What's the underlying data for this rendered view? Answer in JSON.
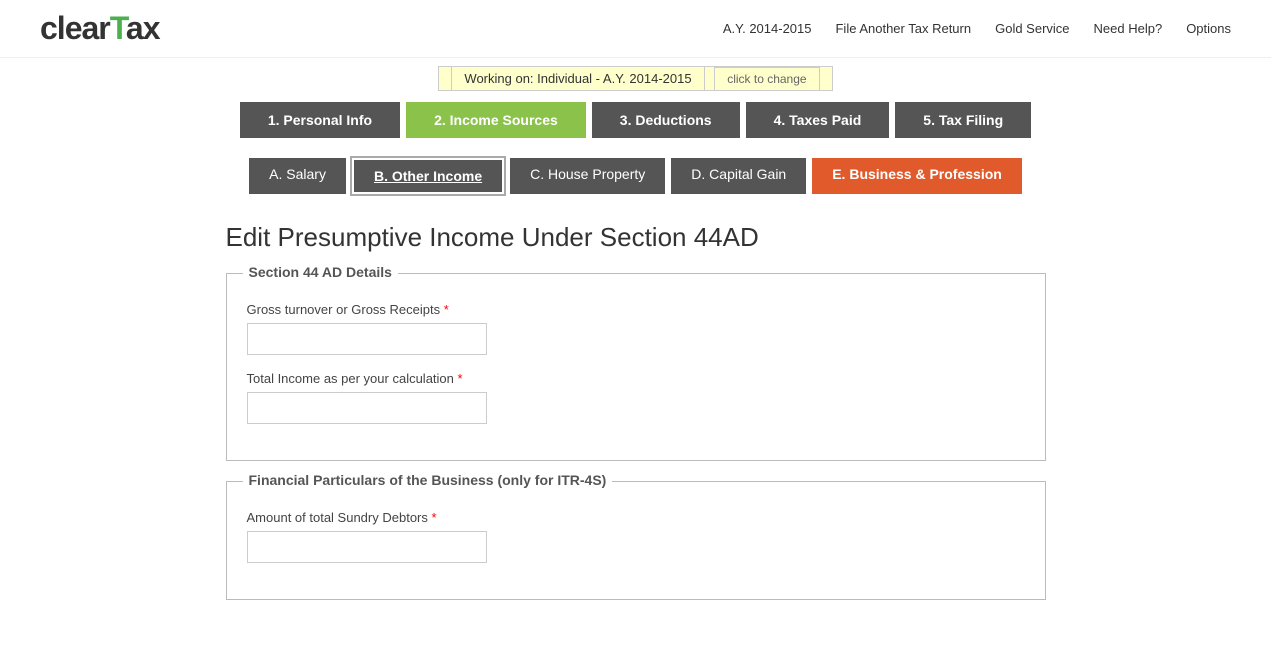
{
  "header": {
    "logo_text": "clearTax",
    "ay_label": "A.Y. 2014-2015",
    "nav": [
      {
        "id": "file-return",
        "label": "File Another Tax Return"
      },
      {
        "id": "gold-service",
        "label": "Gold Service"
      },
      {
        "id": "need-help",
        "label": "Need Help?"
      },
      {
        "id": "options",
        "label": "Options"
      }
    ]
  },
  "working_bar": {
    "text": "Working on: Individual - A.Y. 2014-2015",
    "click_change": "click to change"
  },
  "step_tabs": [
    {
      "id": "personal-info",
      "label": "1. Personal Info",
      "state": "dark"
    },
    {
      "id": "income-sources",
      "label": "2. Income Sources",
      "state": "active"
    },
    {
      "id": "deductions",
      "label": "3. Deductions",
      "state": "dark"
    },
    {
      "id": "taxes-paid",
      "label": "4. Taxes Paid",
      "state": "dark"
    },
    {
      "id": "tax-filing",
      "label": "5. Tax Filing",
      "state": "dark"
    }
  ],
  "sub_tabs": [
    {
      "id": "salary",
      "label": "A. Salary",
      "state": "normal"
    },
    {
      "id": "other-income",
      "label": "B. Other Income",
      "state": "active-border"
    },
    {
      "id": "house-property",
      "label": "C. House Property",
      "state": "normal"
    },
    {
      "id": "capital-gain",
      "label": "D. Capital Gain",
      "state": "normal"
    },
    {
      "id": "business-profession",
      "label": "E. Business & Profession",
      "state": "orange"
    }
  ],
  "page_title": "Edit Presumptive Income Under Section 44AD",
  "section1": {
    "title": "Section 44 AD Details",
    "fields": [
      {
        "id": "gross-turnover",
        "label": "Gross turnover or Gross Receipts",
        "required": true,
        "value": ""
      },
      {
        "id": "total-income",
        "label": "Total Income as per your calculation",
        "required": true,
        "value": ""
      }
    ]
  },
  "section2": {
    "title": "Financial Particulars of the Business (only for ITR-4S)",
    "fields": [
      {
        "id": "sundry-debtors",
        "label": "Amount of total Sundry Debtors",
        "required": true,
        "value": ""
      }
    ]
  }
}
